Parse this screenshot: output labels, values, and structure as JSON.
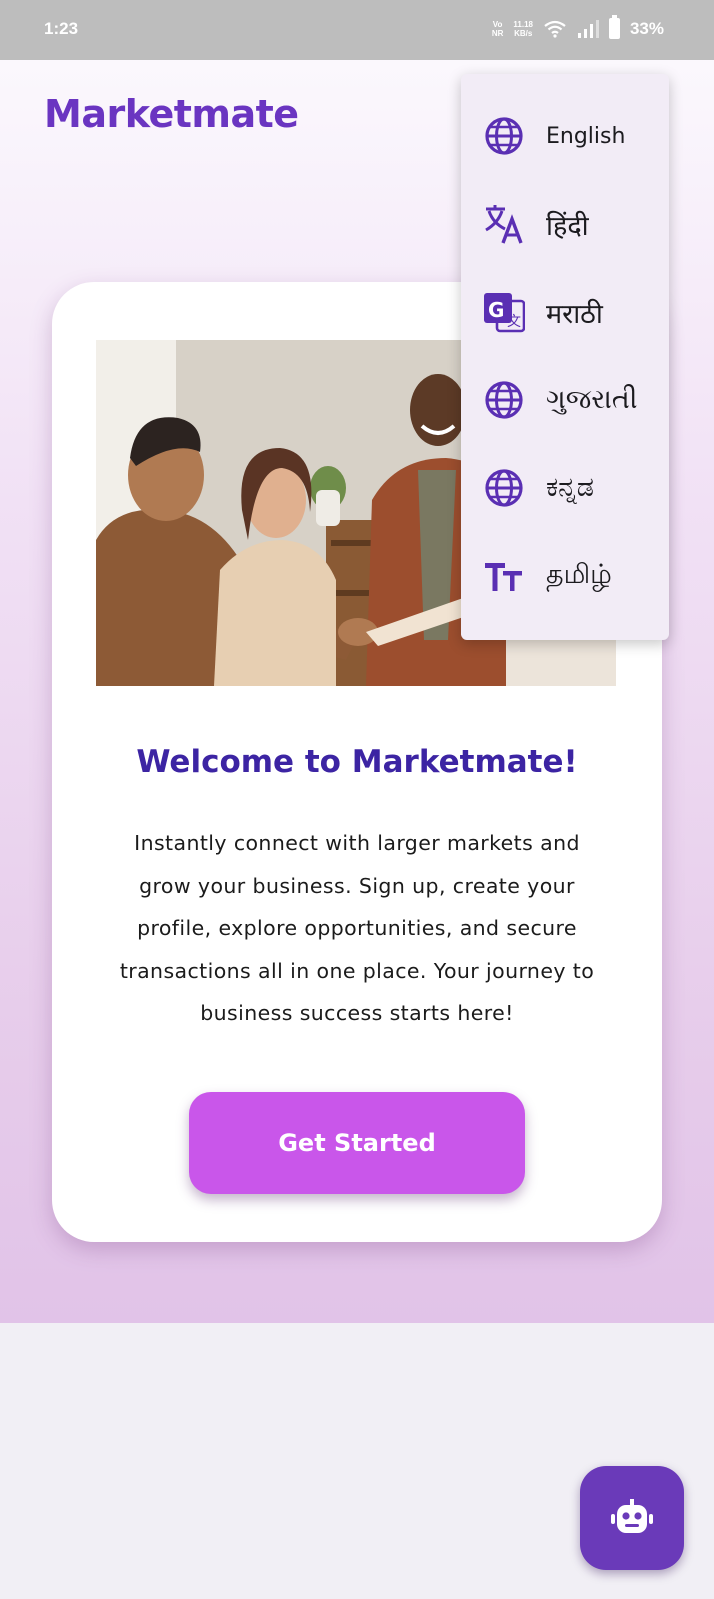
{
  "status_bar": {
    "time": "1:23",
    "net_tag_top": "Vo",
    "net_tag_bottom": "NR",
    "speed_top": "11.18",
    "speed_bottom": "KB/s",
    "battery": "33%"
  },
  "app": {
    "brand": "Marketmate",
    "welcome_title": "Welcome to Marketmate!",
    "description_lines": [
      "Instantly connect with larger markets and",
      "grow your business. Sign up, create your",
      "profile, explore opportunities, and secure",
      "transactions all in one place. Your journey to",
      "business success starts here!"
    ],
    "cta_label": "Get Started"
  },
  "language_menu": {
    "items": [
      {
        "label": "English",
        "icon": "globe-icon"
      },
      {
        "label": "हिंदी",
        "icon": "translate-icon"
      },
      {
        "label": "मराठी",
        "icon": "google-translate-icon"
      },
      {
        "label": "ગુજરાતી",
        "icon": "globe-icon"
      },
      {
        "label": "ಕನ್ನಡ",
        "icon": "globe-icon"
      },
      {
        "label": "தமிழ்",
        "icon": "text-size-icon"
      }
    ]
  },
  "fab": {
    "icon": "robot-icon"
  },
  "colors": {
    "brand": "#6a35c1",
    "title": "#3c24a3",
    "cta": "#c956ea",
    "fab": "#6a3ab9",
    "menu_bg": "#f2ecf6"
  }
}
